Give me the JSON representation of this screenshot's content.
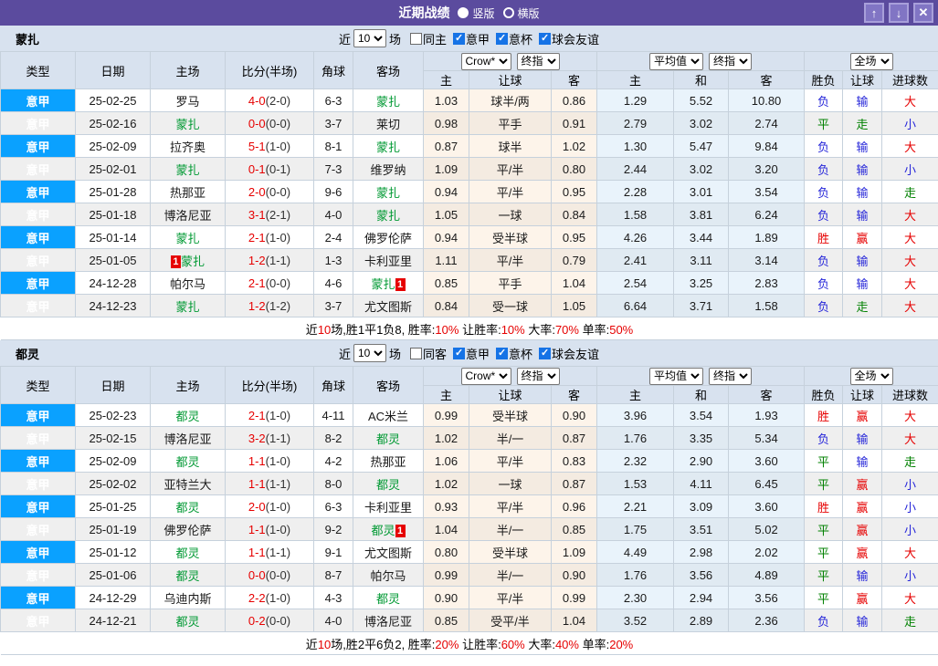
{
  "titlebar": {
    "title": "近期战绩",
    "modes": [
      {
        "label": "竖版",
        "selected": true
      },
      {
        "label": "横版",
        "selected": false
      }
    ],
    "icons": {
      "up": "↑",
      "down": "↓",
      "close": "✕"
    }
  },
  "table_headers": {
    "main": [
      "类型",
      "日期",
      "主场",
      "比分(半场)",
      "角球",
      "客场"
    ],
    "sub": [
      "主",
      "让球",
      "客",
      "主",
      "和",
      "客",
      "胜负",
      "让球",
      "进球数"
    ]
  },
  "header_selects": {
    "bookmaker": "Crow*",
    "bookmaker_final": "终指",
    "average": "平均值",
    "average_final": "终指",
    "scope": "全场"
  },
  "colors": {
    "titlebar_purple": "#5B4B9E",
    "league_blue": "#0AA1FF",
    "team_green": "#009933",
    "score_red": "#E60000",
    "outcome_red": "#E60000",
    "outcome_blue": "#2626D9",
    "outcome_green": "#008000",
    "outcome_map": {
      "胜": "red",
      "赢": "red",
      "大": "red",
      "负": "blue",
      "输": "blue",
      "小": "blue",
      "平": "green",
      "走": "green"
    }
  },
  "sections": [
    {
      "team": "蒙扎",
      "filter": {
        "prefix": "近",
        "count": "10",
        "suffix": "场",
        "checkboxes": [
          {
            "label": "同主",
            "checked": false
          },
          {
            "label": "意甲",
            "checked": true
          },
          {
            "label": "意杯",
            "checked": true
          },
          {
            "label": "球会友谊",
            "checked": true
          }
        ]
      },
      "rows": [
        {
          "league": "意甲",
          "date": "25-02-25",
          "home": "罗马",
          "home_self": false,
          "score": "4-0",
          "half": "(2-0)",
          "corner": "6-3",
          "away": "蒙扎",
          "away_self": true,
          "hw": "1.03",
          "handicap": "球半/两",
          "aw": "0.86",
          "eh": "1.29",
          "ed": "5.52",
          "ea": "10.80",
          "result": "负",
          "cover": "输",
          "goals": "大"
        },
        {
          "league": "意甲",
          "date": "25-02-16",
          "home": "蒙扎",
          "home_self": true,
          "score": "0-0",
          "half": "(0-0)",
          "corner": "3-7",
          "away": "莱切",
          "away_self": false,
          "hw": "0.98",
          "handicap": "平手",
          "aw": "0.91",
          "eh": "2.79",
          "ed": "3.02",
          "ea": "2.74",
          "result": "平",
          "cover": "走",
          "goals": "小"
        },
        {
          "league": "意甲",
          "date": "25-02-09",
          "home": "拉齐奥",
          "home_self": false,
          "score": "5-1",
          "half": "(1-0)",
          "corner": "8-1",
          "away": "蒙扎",
          "away_self": true,
          "hw": "0.87",
          "handicap": "球半",
          "aw": "1.02",
          "eh": "1.30",
          "ed": "5.47",
          "ea": "9.84",
          "result": "负",
          "cover": "输",
          "goals": "大"
        },
        {
          "league": "意甲",
          "date": "25-02-01",
          "home": "蒙扎",
          "home_self": true,
          "score": "0-1",
          "half": "(0-1)",
          "corner": "7-3",
          "away": "维罗纳",
          "away_self": false,
          "hw": "1.09",
          "handicap": "平/半",
          "aw": "0.80",
          "eh": "2.44",
          "ed": "3.02",
          "ea": "3.20",
          "result": "负",
          "cover": "输",
          "goals": "小"
        },
        {
          "league": "意甲",
          "date": "25-01-28",
          "home": "热那亚",
          "home_self": false,
          "score": "2-0",
          "half": "(0-0)",
          "corner": "9-6",
          "away": "蒙扎",
          "away_self": true,
          "hw": "0.94",
          "handicap": "平/半",
          "aw": "0.95",
          "eh": "2.28",
          "ed": "3.01",
          "ea": "3.54",
          "result": "负",
          "cover": "输",
          "goals": "走"
        },
        {
          "league": "意甲",
          "date": "25-01-18",
          "home": "博洛尼亚",
          "home_self": false,
          "score": "3-1",
          "half": "(2-1)",
          "corner": "4-0",
          "away": "蒙扎",
          "away_self": true,
          "hw": "1.05",
          "handicap": "一球",
          "aw": "0.84",
          "eh": "1.58",
          "ed": "3.81",
          "ea": "6.24",
          "result": "负",
          "cover": "输",
          "goals": "大"
        },
        {
          "league": "意甲",
          "date": "25-01-14",
          "home": "蒙扎",
          "home_self": true,
          "score": "2-1",
          "half": "(1-0)",
          "corner": "2-4",
          "away": "佛罗伦萨",
          "away_self": false,
          "hw": "0.94",
          "handicap": "受半球",
          "aw": "0.95",
          "eh": "4.26",
          "ed": "3.44",
          "ea": "1.89",
          "result": "胜",
          "cover": "赢",
          "goals": "大"
        },
        {
          "league": "意甲",
          "date": "25-01-05",
          "home": "蒙扎",
          "home_self": true,
          "home_card": "1",
          "score": "1-2",
          "half": "(1-1)",
          "corner": "1-3",
          "away": "卡利亚里",
          "away_self": false,
          "hw": "1.11",
          "handicap": "平/半",
          "aw": "0.79",
          "eh": "2.41",
          "ed": "3.11",
          "ea": "3.14",
          "result": "负",
          "cover": "输",
          "goals": "大"
        },
        {
          "league": "意甲",
          "date": "24-12-28",
          "home": "帕尔马",
          "home_self": false,
          "score": "2-1",
          "half": "(0-0)",
          "corner": "4-6",
          "away": "蒙扎",
          "away_self": true,
          "away_card": "1",
          "hw": "0.85",
          "handicap": "平手",
          "aw": "1.04",
          "eh": "2.54",
          "ed": "3.25",
          "ea": "2.83",
          "result": "负",
          "cover": "输",
          "goals": "大"
        },
        {
          "league": "意甲",
          "date": "24-12-23",
          "home": "蒙扎",
          "home_self": true,
          "score": "1-2",
          "half": "(1-2)",
          "corner": "3-7",
          "away": "尤文图斯",
          "away_self": false,
          "hw": "0.84",
          "handicap": "受一球",
          "aw": "1.05",
          "eh": "6.64",
          "ed": "3.71",
          "ea": "1.58",
          "result": "负",
          "cover": "走",
          "goals": "大"
        }
      ],
      "summary": [
        {
          "text": "近"
        },
        {
          "text": "10",
          "red": true
        },
        {
          "text": "场,胜1平1负8, 胜率:"
        },
        {
          "text": "10%",
          "red": true
        },
        {
          "text": " 让胜率:"
        },
        {
          "text": "10%",
          "red": true
        },
        {
          "text": " 大率:"
        },
        {
          "text": "70%",
          "red": true
        },
        {
          "text": " 单率:"
        },
        {
          "text": "50%",
          "red": true
        }
      ]
    },
    {
      "team": "都灵",
      "filter": {
        "prefix": "近",
        "count": "10",
        "suffix": "场",
        "checkboxes": [
          {
            "label": "同客",
            "checked": false
          },
          {
            "label": "意甲",
            "checked": true
          },
          {
            "label": "意杯",
            "checked": true
          },
          {
            "label": "球会友谊",
            "checked": true
          }
        ]
      },
      "rows": [
        {
          "league": "意甲",
          "date": "25-02-23",
          "home": "都灵",
          "home_self": true,
          "score": "2-1",
          "half": "(1-0)",
          "corner": "4-11",
          "away": "AC米兰",
          "away_self": false,
          "hw": "0.99",
          "handicap": "受半球",
          "aw": "0.90",
          "eh": "3.96",
          "ed": "3.54",
          "ea": "1.93",
          "result": "胜",
          "cover": "赢",
          "goals": "大"
        },
        {
          "league": "意甲",
          "date": "25-02-15",
          "home": "博洛尼亚",
          "home_self": false,
          "score": "3-2",
          "half": "(1-1)",
          "corner": "8-2",
          "away": "都灵",
          "away_self": true,
          "hw": "1.02",
          "handicap": "半/一",
          "aw": "0.87",
          "eh": "1.76",
          "ed": "3.35",
          "ea": "5.34",
          "result": "负",
          "cover": "输",
          "goals": "大"
        },
        {
          "league": "意甲",
          "date": "25-02-09",
          "home": "都灵",
          "home_self": true,
          "score": "1-1",
          "half": "(1-0)",
          "corner": "4-2",
          "away": "热那亚",
          "away_self": false,
          "hw": "1.06",
          "handicap": "平/半",
          "aw": "0.83",
          "eh": "2.32",
          "ed": "2.90",
          "ea": "3.60",
          "result": "平",
          "cover": "输",
          "goals": "走"
        },
        {
          "league": "意甲",
          "date": "25-02-02",
          "home": "亚特兰大",
          "home_self": false,
          "score": "1-1",
          "half": "(1-1)",
          "corner": "8-0",
          "away": "都灵",
          "away_self": true,
          "hw": "1.02",
          "handicap": "一球",
          "aw": "0.87",
          "eh": "1.53",
          "ed": "4.11",
          "ea": "6.45",
          "result": "平",
          "cover": "赢",
          "goals": "小"
        },
        {
          "league": "意甲",
          "date": "25-01-25",
          "home": "都灵",
          "home_self": true,
          "score": "2-0",
          "half": "(1-0)",
          "corner": "6-3",
          "away": "卡利亚里",
          "away_self": false,
          "hw": "0.93",
          "handicap": "平/半",
          "aw": "0.96",
          "eh": "2.21",
          "ed": "3.09",
          "ea": "3.60",
          "result": "胜",
          "cover": "赢",
          "goals": "小"
        },
        {
          "league": "意甲",
          "date": "25-01-19",
          "home": "佛罗伦萨",
          "home_self": false,
          "score": "1-1",
          "half": "(1-0)",
          "corner": "9-2",
          "away": "都灵",
          "away_self": true,
          "away_card": "1",
          "hw": "1.04",
          "handicap": "半/一",
          "aw": "0.85",
          "eh": "1.75",
          "ed": "3.51",
          "ea": "5.02",
          "result": "平",
          "cover": "赢",
          "goals": "小"
        },
        {
          "league": "意甲",
          "date": "25-01-12",
          "home": "都灵",
          "home_self": true,
          "score": "1-1",
          "half": "(1-1)",
          "corner": "9-1",
          "away": "尤文图斯",
          "away_self": false,
          "hw": "0.80",
          "handicap": "受半球",
          "aw": "1.09",
          "eh": "4.49",
          "ed": "2.98",
          "ea": "2.02",
          "result": "平",
          "cover": "赢",
          "goals": "大"
        },
        {
          "league": "意甲",
          "date": "25-01-06",
          "home": "都灵",
          "home_self": true,
          "score": "0-0",
          "half": "(0-0)",
          "corner": "8-7",
          "away": "帕尔马",
          "away_self": false,
          "hw": "0.99",
          "handicap": "半/一",
          "aw": "0.90",
          "eh": "1.76",
          "ed": "3.56",
          "ea": "4.89",
          "result": "平",
          "cover": "输",
          "goals": "小"
        },
        {
          "league": "意甲",
          "date": "24-12-29",
          "home": "乌迪内斯",
          "home_self": false,
          "score": "2-2",
          "half": "(1-0)",
          "corner": "4-3",
          "away": "都灵",
          "away_self": true,
          "hw": "0.90",
          "handicap": "平/半",
          "aw": "0.99",
          "eh": "2.30",
          "ed": "2.94",
          "ea": "3.56",
          "result": "平",
          "cover": "赢",
          "goals": "大"
        },
        {
          "league": "意甲",
          "date": "24-12-21",
          "home": "都灵",
          "home_self": true,
          "score": "0-2",
          "half": "(0-0)",
          "corner": "4-0",
          "away": "博洛尼亚",
          "away_self": false,
          "hw": "0.85",
          "handicap": "受平/半",
          "aw": "1.04",
          "eh": "3.52",
          "ed": "2.89",
          "ea": "2.36",
          "result": "负",
          "cover": "输",
          "goals": "走"
        }
      ],
      "summary": [
        {
          "text": "近"
        },
        {
          "text": "10",
          "red": true
        },
        {
          "text": "场,胜2平6负2, 胜率:"
        },
        {
          "text": "20%",
          "red": true
        },
        {
          "text": " 让胜率:"
        },
        {
          "text": "60%",
          "red": true
        },
        {
          "text": " 大率:"
        },
        {
          "text": "40%",
          "red": true
        },
        {
          "text": " 单率:"
        },
        {
          "text": "20%",
          "red": true
        }
      ]
    }
  ]
}
